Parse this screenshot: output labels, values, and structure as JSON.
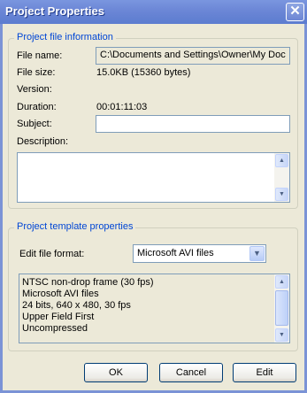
{
  "window": {
    "title": "Project Properties",
    "close_glyph": "✕"
  },
  "file_info": {
    "legend": "Project file information",
    "file_name_label": "File name:",
    "file_name_value": "C:\\Documents and Settings\\Owner\\My Doc",
    "file_size_label": "File size:",
    "file_size_value": "15.0KB (15360 bytes)",
    "version_label": "Version:",
    "duration_label": "Duration:",
    "duration_value": "00:01:11:03",
    "subject_label": "Subject:",
    "subject_value": "",
    "description_label": "Description:",
    "description_value": ""
  },
  "template": {
    "legend": "Project template properties",
    "format_label": "Edit file format:",
    "format_selected": "Microsoft AVI files",
    "details": [
      "NTSC non-drop frame (30 fps)",
      "Microsoft AVI files",
      "24 bits, 640 x 480, 30 fps",
      "Upper Field First",
      "Uncompressed"
    ]
  },
  "buttons": {
    "ok": "OK",
    "cancel": "Cancel",
    "edit": "Edit"
  },
  "icons": {
    "scroll_up": "▲",
    "scroll_down": "▼",
    "dropdown": "▼"
  },
  "colors": {
    "title_bar": "#6b86d6",
    "group_legend": "#0046d5",
    "dialog_bg": "#ece9d8"
  }
}
